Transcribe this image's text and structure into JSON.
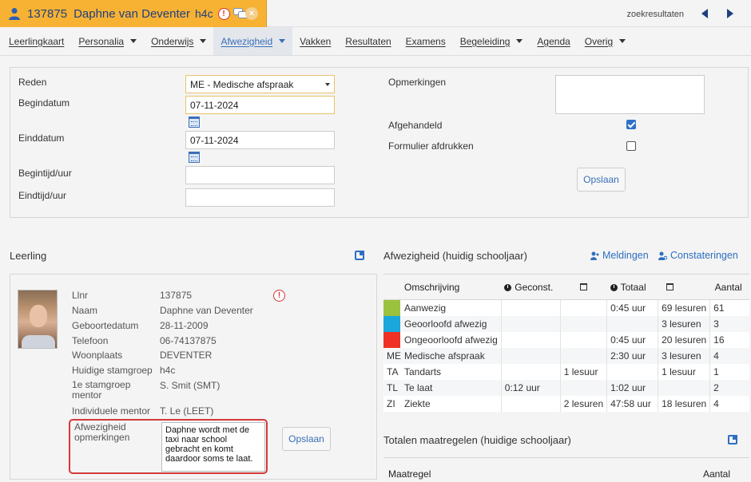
{
  "tab": {
    "student_number": "137875",
    "student_name": "Daphne van Deventer",
    "klas": "h4c",
    "zoekresultaten": "zoekresultaten"
  },
  "menu": [
    {
      "label": "Leerlingkaart",
      "dropdown": false,
      "active": false
    },
    {
      "label": "Personalia",
      "dropdown": true,
      "active": false
    },
    {
      "label": "Onderwijs",
      "dropdown": true,
      "active": false
    },
    {
      "label": "Afwezigheid",
      "dropdown": true,
      "active": true
    },
    {
      "label": "Vakken",
      "dropdown": false,
      "active": false
    },
    {
      "label": "Resultaten",
      "dropdown": false,
      "active": false
    },
    {
      "label": "Examens",
      "dropdown": false,
      "active": false
    },
    {
      "label": "Begeleiding",
      "dropdown": true,
      "active": false
    },
    {
      "label": "Agenda",
      "dropdown": false,
      "active": false
    },
    {
      "label": "Overig",
      "dropdown": true,
      "active": false
    }
  ],
  "form": {
    "reden_label": "Reden",
    "reden_value": "ME - Medische afspraak",
    "begindatum_label": "Begindatum",
    "begindatum_value": "07-11-2024",
    "einddatum_label": "Einddatum",
    "einddatum_value": "07-11-2024",
    "begintijd_label": "Begintijd/uur",
    "begintijd_value": "",
    "eindtijd_label": "Eindtijd/uur",
    "eindtijd_value": "",
    "opmerkingen_label": "Opmerkingen",
    "opmerkingen_value": "",
    "afgehandeld_label": "Afgehandeld",
    "afgehandeld_checked": true,
    "formulier_label": "Formulier afdrukken",
    "formulier_checked": false,
    "save_label": "Opslaan"
  },
  "leerling": {
    "title": "Leerling",
    "rows": [
      {
        "label": "Llnr",
        "value": "137875"
      },
      {
        "label": "Naam",
        "value": "Daphne van Deventer"
      },
      {
        "label": "Geboortedatum",
        "value": "28-11-2009"
      },
      {
        "label": "Telefoon",
        "value": "06-74137875"
      },
      {
        "label": "Woonplaats",
        "value": "DEVENTER"
      },
      {
        "label": "Huidige stamgroep",
        "value": "h4c"
      },
      {
        "label": "1e stamgroep mentor",
        "value": "S. Smit (SMT)"
      },
      {
        "label": "Individuele mentor",
        "value": "T. Le (LEET)"
      }
    ],
    "note_label": "Afwezigheid opmerkingen",
    "note_value": "Daphne wordt met de taxi naar school gebracht en komt daardoor soms te laat.",
    "save_label": "Opslaan"
  },
  "afwezigheid": {
    "title": "Afwezigheid (huidig schooljaar)",
    "meldingen_label": "Meldingen",
    "constateringen_label": "Constateringen",
    "headers": [
      "Omschrijving",
      "Geconst.",
      "Totaal",
      "Aantal"
    ],
    "rows": [
      {
        "code": "",
        "color": "#9bc23c",
        "omschrijving": "Aanwezig",
        "geconst": "",
        "geconst_les": "",
        "totaal": "0:45 uur",
        "totaal_les": "69 lesuren",
        "aantal": "61"
      },
      {
        "code": "",
        "color": "#1aa7dc",
        "omschrijving": "Geoorloofd afwezig",
        "geconst": "",
        "geconst_les": "",
        "totaal": "",
        "totaal_les": "3 lesuren",
        "aantal": "3"
      },
      {
        "code": "",
        "color": "#ee3124",
        "omschrijving": "Ongeoorloofd afwezig",
        "geconst": "",
        "geconst_les": "",
        "totaal": "0:45 uur",
        "totaal_les": "20 lesuren",
        "aantal": "16"
      },
      {
        "code": "ME",
        "color": "",
        "omschrijving": "Medische afspraak",
        "geconst": "",
        "geconst_les": "",
        "totaal": "2:30 uur",
        "totaal_les": "3 lesuren",
        "aantal": "4"
      },
      {
        "code": "TA",
        "color": "",
        "omschrijving": "Tandarts",
        "geconst": "",
        "geconst_les": "1 lesuur",
        "totaal": "",
        "totaal_les": "1 lesuur",
        "aantal": "1"
      },
      {
        "code": "TL",
        "color": "",
        "omschrijving": "Te laat",
        "geconst": "0:12 uur",
        "geconst_les": "",
        "totaal": "1:02 uur",
        "totaal_les": "",
        "aantal": "2"
      },
      {
        "code": "ZI",
        "color": "",
        "omschrijving": "Ziekte",
        "geconst": "",
        "geconst_les": "2 lesuren",
        "totaal": "47:58 uur",
        "totaal_les": "18 lesuren",
        "aantal": "4"
      }
    ]
  },
  "maatregelen": {
    "title": "Totalen maatregelen (huidige schooljaar)",
    "col_maatregel": "Maatregel",
    "col_aantal": "Aantal"
  }
}
